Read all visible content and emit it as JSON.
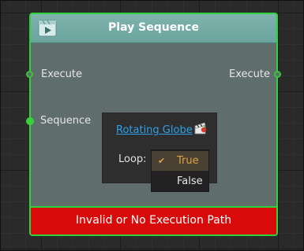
{
  "node": {
    "title": "Play Sequence",
    "icon": "film-sequence-icon",
    "inputs": [
      {
        "label": "Execute"
      },
      {
        "label": "Sequence"
      }
    ],
    "outputs": [
      {
        "label": "Execute"
      }
    ],
    "error": "Invalid or No Execution Path"
  },
  "popup": {
    "sequence_link": "Rotating Globe",
    "loop_label": "Loop:",
    "loop_options": [
      "True",
      "False"
    ],
    "loop_selected": "True"
  },
  "colors": {
    "connected_port": "#37d23a",
    "header": "#7fb3ad",
    "error_bg": "#d80a0a",
    "link": "#2fa0e8",
    "selected_option": "#d9a441"
  }
}
